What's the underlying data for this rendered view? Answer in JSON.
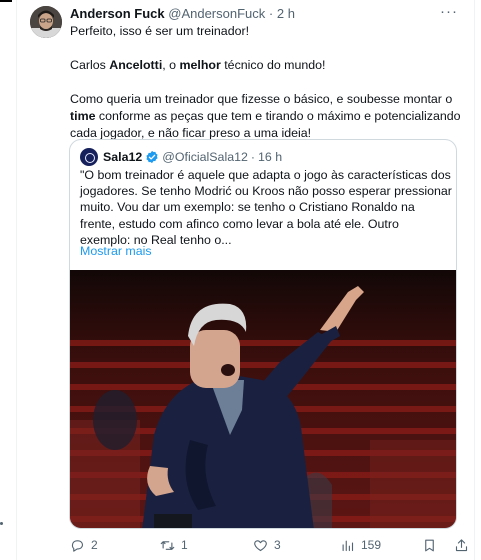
{
  "tweet": {
    "author_name": "Anderson Fuck",
    "author_handle": "@AndersonFuck",
    "separator": "·",
    "time": "2 h",
    "more_icon": "more-icon",
    "paragraph1": "Perfeito, isso é ser um treinador!",
    "p2_part1": "Carlos ",
    "p2_bold1": "Ancelotti",
    "p2_part2": ", o ",
    "p2_bold2": "melhor",
    "p2_part3": " técnico do mundo!",
    "p3_part1": "Como queria um treinador que fizesse o básico, e soubesse montar o ",
    "p3_bold1": "time",
    "p3_part2": " conforme as peças que tem e tirando o máximo e potencializando cada jogador, e não ficar preso a uma ideia!"
  },
  "quote": {
    "author_name": "Sala12",
    "verified_icon": "verified-icon",
    "author_handle": "@OficialSala12",
    "separator": "·",
    "time": "16 h",
    "text": "\"O bom treinador é aquele que adapta o jogo às características dos jogadores. Se tenho Modrić ou Kroos não posso esperar pressionar muito. Vou dar um exemplo: se tenho o Cristiano Ronaldo na frente, estudo com afinco como levar a bola até ele. Outro exemplo: no Real tenho o...",
    "show_more": "Mostrar mais"
  },
  "actions": {
    "reply_count": "2",
    "retweet_count": "1",
    "like_count": "3",
    "views_count": "159"
  },
  "colors": {
    "text_primary": "#0f1419",
    "text_secondary": "#536471",
    "link": "#1d9bf0",
    "border": "#cfd9de",
    "verified": "#1d9bf0"
  }
}
